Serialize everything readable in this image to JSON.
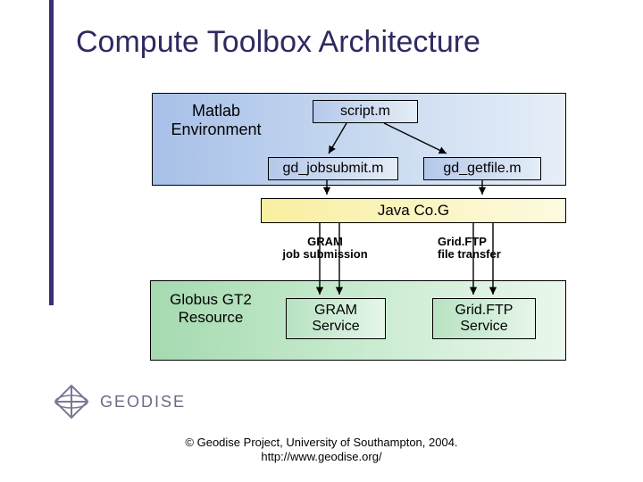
{
  "title": "Compute Toolbox Architecture",
  "matlab": {
    "label_line1": "Matlab",
    "label_line2": "Environment",
    "script": "script.m",
    "jobsubmit": "gd_jobsubmit.m",
    "getfile": "gd_getfile.m"
  },
  "javacog": "Java Co.G",
  "transitions": {
    "gram_line1": "GRAM",
    "gram_line2": "job submission",
    "gridftp_line1": "Grid.FTP",
    "gridftp_line2": "file transfer"
  },
  "globus": {
    "label_line1": "Globus GT2",
    "label_line2": "Resource",
    "gram_line1": "GRAM",
    "gram_line2": "Service",
    "gridftp_line1": "Grid.FTP",
    "gridftp_line2": "Service"
  },
  "logo": "GEODISE",
  "footer": {
    "line1": "© Geodise Project, University of Southampton, 2004.",
    "line2": "http://www.geodise.org/"
  }
}
